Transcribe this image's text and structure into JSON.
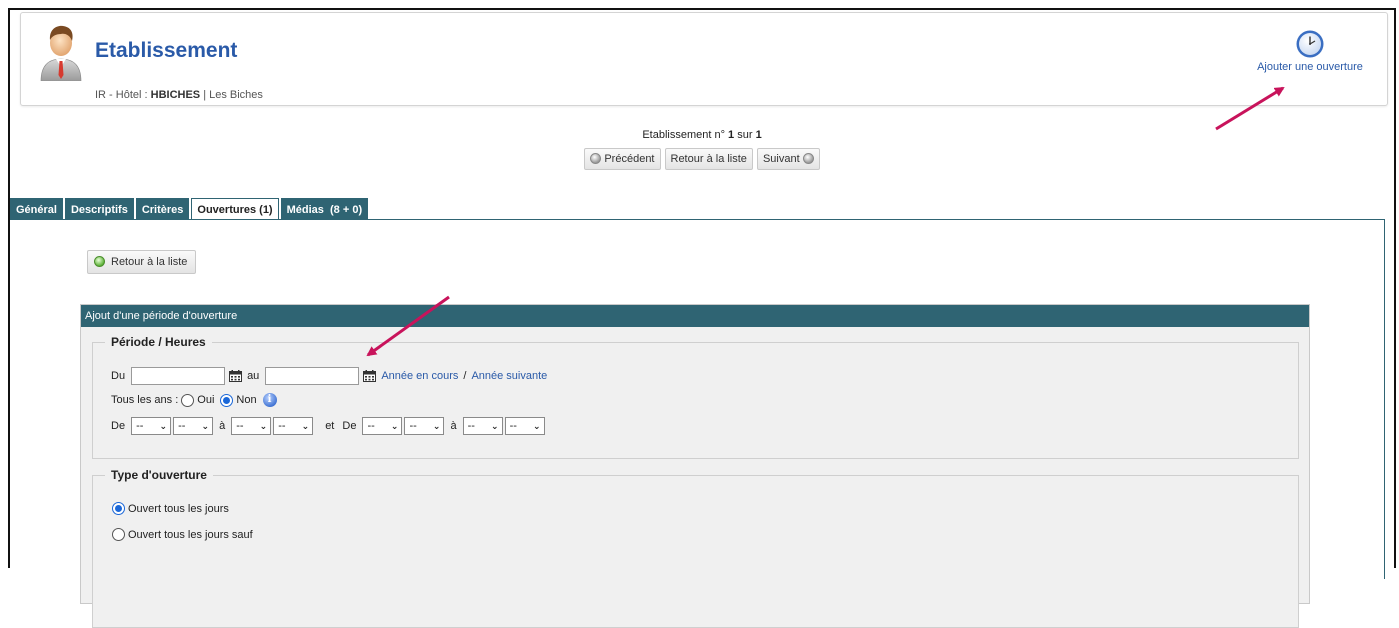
{
  "header": {
    "title": "Etablissement",
    "subtitle_prefix": "IR - Hôtel : ",
    "subtitle_code": "HBICHES",
    "subtitle_suffix": " | Les Biches",
    "add_opening_label": "Ajouter une ouverture"
  },
  "nav": {
    "count_prefix": "Etablissement n° ",
    "current": "1",
    "count_mid": " sur ",
    "total": "1",
    "prev_label": "Précédent",
    "list_label": "Retour à la liste",
    "next_label": "Suivant"
  },
  "tabs": [
    {
      "label": "Général",
      "active": false
    },
    {
      "label": "Descriptifs",
      "active": false
    },
    {
      "label": "Critères",
      "active": false
    },
    {
      "label": "Ouvertures (1)",
      "active": true
    },
    {
      "label": "Médias  (8 + 0)",
      "active": false
    }
  ],
  "panel": {
    "back_label": "Retour à la liste",
    "section_title": "Ajout d'une période d'ouverture",
    "period": {
      "legend": "Période / Heures",
      "from_label": "Du",
      "from_value": "",
      "to_label": "au",
      "to_value": "",
      "current_year_link": "Année en cours",
      "separator": "/",
      "next_year_link": "Année suivante",
      "yearly_label": "Tous les ans :",
      "yes_label": "Oui",
      "no_label": "Non",
      "yearly_selected": "Non",
      "hours_from_label": "De",
      "hours_to_label": "à",
      "and_label": "et",
      "select_placeholder": "--"
    },
    "type": {
      "legend": "Type d'ouverture",
      "options": [
        {
          "label": "Ouvert tous les jours",
          "selected": true
        },
        {
          "label": "Ouvert tous les jours sauf",
          "selected": false
        }
      ]
    }
  },
  "colors": {
    "accent_teal": "#2f6473",
    "title_blue": "#2a5aa8",
    "annotation_arrow": "#c8135b"
  }
}
